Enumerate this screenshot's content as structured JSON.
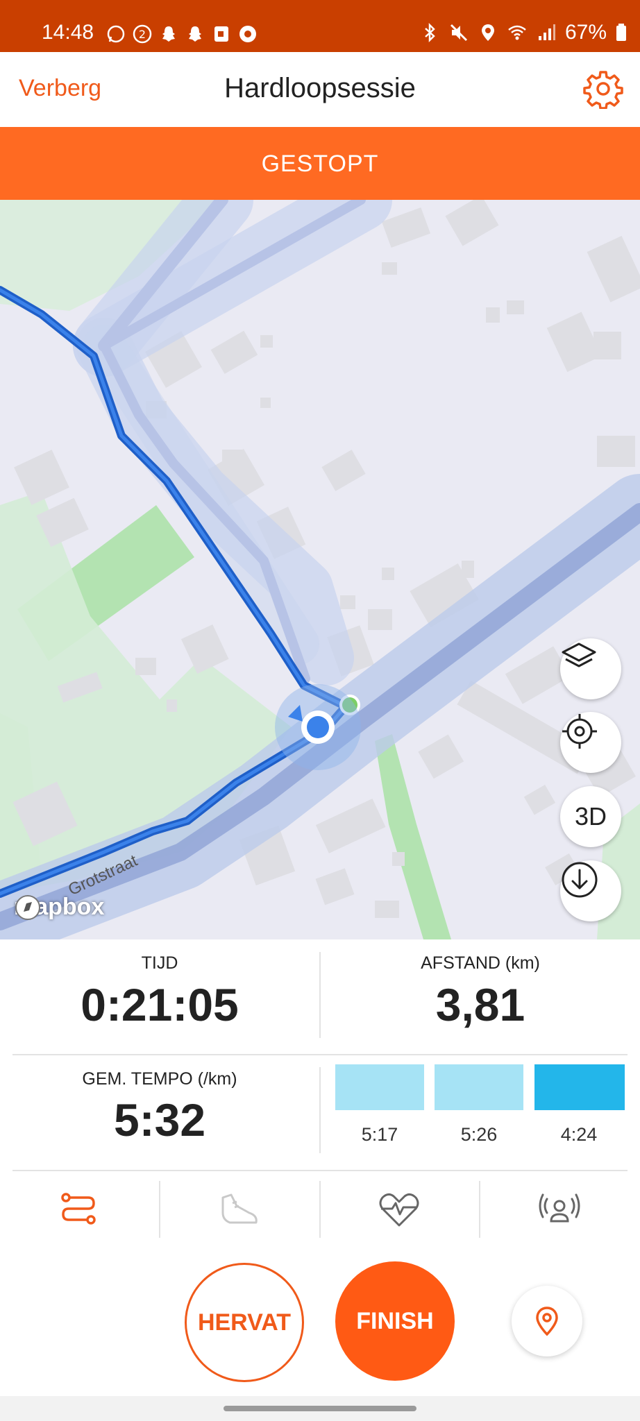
{
  "status_bar": {
    "time": "14:48",
    "battery": "67%",
    "left_icons": [
      "whatsapp-icon",
      "badge-2-icon",
      "snapchat-icon",
      "snapchat-icon",
      "app-icon",
      "record-icon"
    ],
    "right_icons": [
      "bluetooth-icon",
      "mute-icon",
      "location-icon",
      "wifi-icon",
      "signal-icon",
      "battery-icon"
    ]
  },
  "header": {
    "hide_label": "Verberg",
    "title": "Hardloopsessie",
    "settings_icon": "gear-icon"
  },
  "state_banner": {
    "text": "GESTOPT"
  },
  "map": {
    "street_label": "Grotstraat",
    "attribution": "mapbox",
    "buttons": {
      "layers_icon": "layers-icon",
      "recenter_icon": "crosshair-icon",
      "three_d_label": "3D",
      "download_icon": "download-icon"
    }
  },
  "stats": {
    "time_label": "TIJD",
    "time_value": "0:21:05",
    "distance_label": "AFSTAND (km)",
    "distance_value": "3,81",
    "pace_label": "GEM. TEMPO (/km)",
    "pace_value": "5:32",
    "splits": [
      {
        "label": "5:17",
        "color": "#a6e3f5"
      },
      {
        "label": "5:26",
        "color": "#a6e3f5"
      },
      {
        "label": "4:24",
        "color": "#23b6ea"
      }
    ]
  },
  "tabs": [
    {
      "icon": "route-icon",
      "active": true
    },
    {
      "icon": "shoe-icon",
      "active": false
    },
    {
      "icon": "heart-rate-icon",
      "active": false
    },
    {
      "icon": "live-broadcast-icon",
      "active": false
    }
  ],
  "actions": {
    "resume_label": "HERVAT",
    "finish_label": "FINISH",
    "location_icon": "location-pin-icon"
  },
  "colors": {
    "accent": "#f05a1a",
    "status_bar": "#c93f00",
    "banner": "#ff6a22"
  }
}
